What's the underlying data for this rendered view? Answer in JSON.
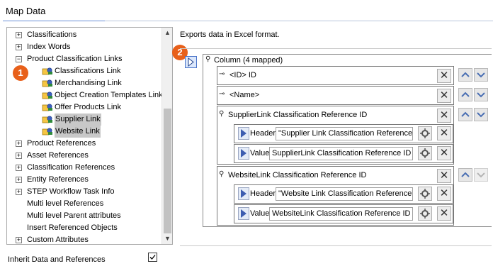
{
  "header": {
    "title": "Map Data"
  },
  "tree": {
    "items": [
      {
        "label": "Classifications",
        "expander": "+",
        "selected": false
      },
      {
        "label": "Index Words",
        "expander": "+",
        "selected": false
      },
      {
        "label": "Product Classification Links",
        "expander": "−",
        "selected": false
      },
      {
        "label": "Classifications Link",
        "expander": "",
        "selected": false
      },
      {
        "label": "Merchandising Link",
        "expander": "",
        "selected": false
      },
      {
        "label": "Object Creation Templates Link",
        "expander": "",
        "selected": false
      },
      {
        "label": "Offer Products Link",
        "expander": "",
        "selected": false
      },
      {
        "label": "Supplier Link",
        "expander": "",
        "selected": true
      },
      {
        "label": "Website Link",
        "expander": "",
        "selected": true
      },
      {
        "label": "Product References",
        "expander": "+",
        "selected": false
      },
      {
        "label": "Asset References",
        "expander": "+",
        "selected": false
      },
      {
        "label": "Classification References",
        "expander": "+",
        "selected": false
      },
      {
        "label": "Entity References",
        "expander": "+",
        "selected": false
      },
      {
        "label": "STEP Workflow Task Info",
        "expander": "+",
        "selected": false
      },
      {
        "label": "Multi level References",
        "expander": "",
        "selected": false
      },
      {
        "label": "Multi level Parent attributes",
        "expander": "",
        "selected": false
      },
      {
        "label": "Insert Referenced Objects",
        "expander": "",
        "selected": false
      },
      {
        "label": "Custom Attributes",
        "expander": "+",
        "selected": false
      }
    ]
  },
  "badges": {
    "one": "1",
    "two": "2"
  },
  "panel": {
    "description": "Exports data in Excel format.",
    "column_label": "Column (4 mapped)",
    "rows": [
      {
        "label": "<ID> ID"
      },
      {
        "label": "<Name>"
      },
      {
        "label": "SupplierLink Classification Reference ID",
        "header_label": "Header",
        "header_value": "\"Supplier Link Classification Reference\"",
        "value_label": "Value",
        "value_value": "SupplierLink Classification Reference ID"
      },
      {
        "label": "WebsiteLink Classification Reference ID",
        "header_label": "Header",
        "header_value": "\"Website Link Classification Reference\"",
        "value_label": "Value",
        "value_value": "WebsiteLink Classification Reference ID"
      }
    ]
  },
  "footer": {
    "inherit_label": "Inherit Data and References",
    "inherit_checked": true
  },
  "colors": {
    "badge": "#e8601a",
    "selection": "#c8c8c8",
    "accent": "#4a74c9"
  },
  "icons": [
    "expander-icon",
    "reference-link-icon",
    "play-icon",
    "pin-icon",
    "key-icon",
    "close-icon",
    "move-up-icon",
    "move-down-icon",
    "configure-icon",
    "checkbox-icon"
  ]
}
